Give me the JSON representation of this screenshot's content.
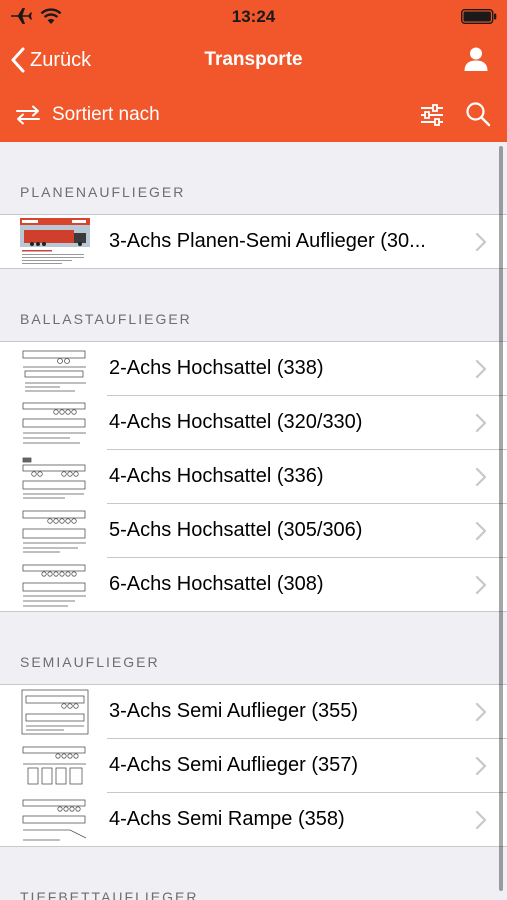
{
  "status_bar": {
    "time": "13:24",
    "icons": [
      "airplane-icon",
      "wifi-icon",
      "battery-icon"
    ]
  },
  "nav": {
    "back_label": "Zurück",
    "title": "Transporte",
    "right_icon": "user-icon"
  },
  "toolbar": {
    "sort_label": "Sortiert nach",
    "sort_icon": "swap-arrows-icon",
    "filter_icon": "sliders-icon",
    "search_icon": "search-icon"
  },
  "colors": {
    "accent": "#f1572a",
    "background": "#efeff4",
    "separator": "#c8c7cc",
    "section_text": "#6d6d72"
  },
  "sections": [
    {
      "title": "PLANENAUFLIEGER",
      "items": [
        {
          "label": "3-Achs Planen-Semi Auflieger (30..."
        }
      ]
    },
    {
      "title": "BALLASTAUFLIEGER",
      "items": [
        {
          "label": "2-Achs Hochsattel (338)"
        },
        {
          "label": "4-Achs Hochsattel (320/330)"
        },
        {
          "label": "4-Achs Hochsattel (336)"
        },
        {
          "label": "5-Achs Hochsattel (305/306)"
        },
        {
          "label": "6-Achs Hochsattel (308)"
        }
      ]
    },
    {
      "title": "SEMIAUFLIEGER",
      "items": [
        {
          "label": "3-Achs Semi Auflieger (355)"
        },
        {
          "label": "4-Achs Semi Auflieger (357)"
        },
        {
          "label": "4-Achs Semi Rampe (358)"
        }
      ]
    },
    {
      "title": "TIEFBETTAUFLIEGER",
      "items": []
    }
  ]
}
